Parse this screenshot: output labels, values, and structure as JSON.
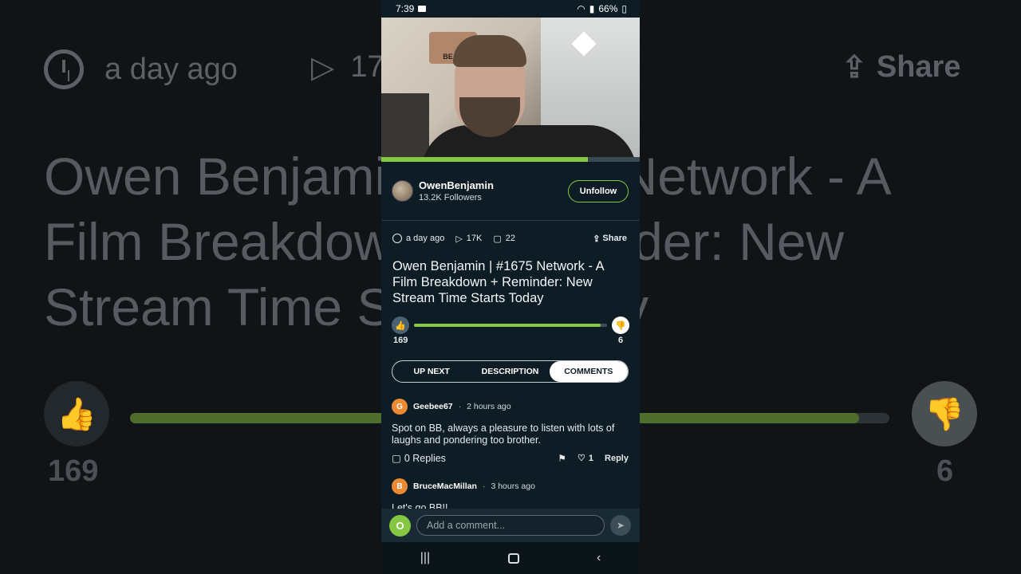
{
  "status_bar": {
    "time": "7:39",
    "battery": "66%"
  },
  "video": {
    "progress_fraction": 0.8,
    "sign_text": "BEAR"
  },
  "channel": {
    "name": "OwenBenjamin",
    "followers": "13.2K Followers",
    "unfollow_label": "Unfollow"
  },
  "meta": {
    "time_ago": "a day ago",
    "views": "17K",
    "comments": "22",
    "share_label": "Share"
  },
  "title": "Owen Benjamin | #1675 Network - A Film Breakdown + Reminder: New Stream Time Starts Today",
  "rating": {
    "likes": "169",
    "dislikes": "6",
    "like_fraction": 0.966
  },
  "tabs": [
    {
      "label": "UP NEXT",
      "active": false
    },
    {
      "label": "DESCRIPTION",
      "active": false
    },
    {
      "label": "COMMENTS",
      "active": true
    }
  ],
  "comments": [
    {
      "initial": "G",
      "user": "Geebee67",
      "time": "2 hours ago",
      "body": "Spot on BB, always a pleasure to listen with lots of laughs and pondering too brother.",
      "replies": "0 Replies",
      "likes": "1",
      "reply_label": "Reply"
    },
    {
      "initial": "B",
      "user": "BruceMacMillan",
      "time": "3 hours ago",
      "body": "Let's go BB!!"
    }
  ],
  "composer": {
    "initial": "O",
    "placeholder": "Add a comment..."
  },
  "background": {
    "time_ago": "a day ago",
    "views": "17K",
    "share_label": "Share",
    "title": "Owen Benjamin | #1675 Network - A Film Breakdown + Reminder: New Stream Time Starts Today",
    "likes": "169",
    "dislikes": "6"
  },
  "colors": {
    "accent": "#85c742",
    "panel": "#0e1d25",
    "comment_avatar": "#ea8a33"
  },
  "icons": [
    "clock-icon",
    "play-icon",
    "comment-icon",
    "share-icon",
    "thumbs-up-icon",
    "thumbs-down-icon",
    "flag-icon",
    "heart-icon",
    "send-icon"
  ]
}
